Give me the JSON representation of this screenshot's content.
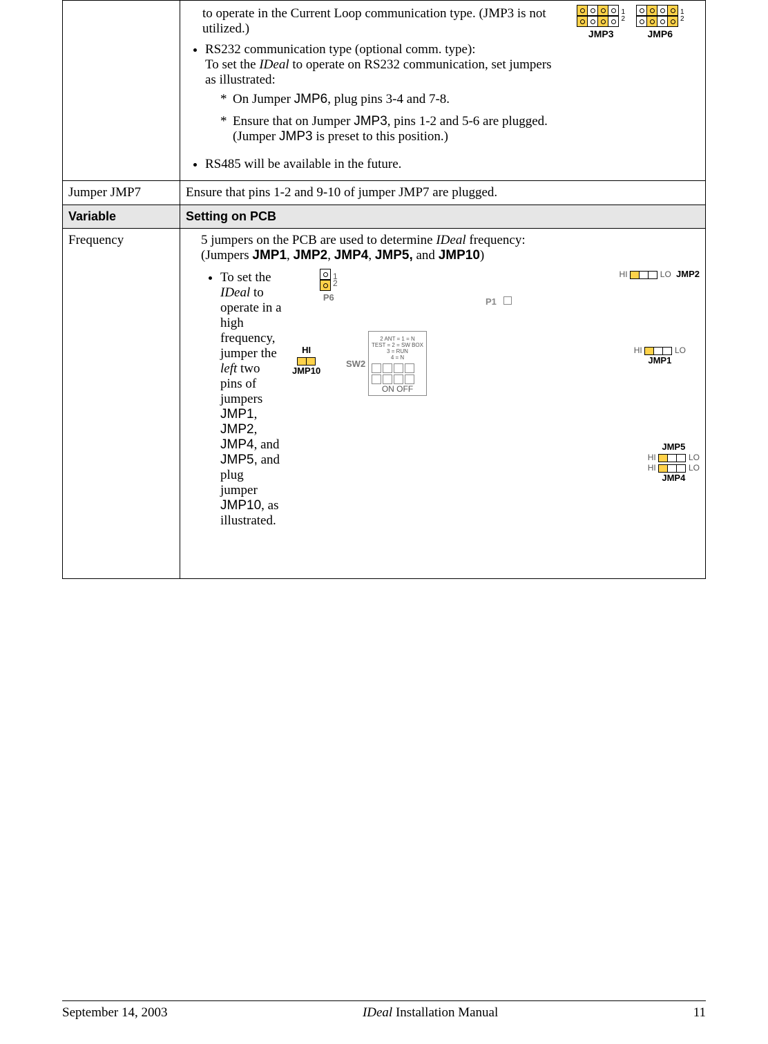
{
  "row1": {
    "para_top": "to operate in the Current Loop communication type.  (JMP3 is not utilized.)",
    "li2_a": "RS232 communication type (optional comm. type):",
    "li2_b_pre": "To set the ",
    "li2_b_ital": "IDeal",
    "li2_b_post": " to operate on RS232 communication, set jumpers as illustrated:",
    "star1_pre": "On Jumper ",
    "star1_j": "JMP6",
    "star1_post": ", plug pins 3-4 and 7-8.",
    "star2_pre": "Ensure that on Jumper ",
    "star2_j": "JMP3",
    "star2_mid": ", pins 1-2 and 5-6 are plugged.  (Jumper ",
    "star2_j2": "JMP3",
    "star2_post": " is preset to this position.)",
    "li3": "RS485 will be available in the future.",
    "jmp3_label": "JMP3",
    "jmp6_label": "JMP6",
    "rownum1": "1",
    "rownum2": "2"
  },
  "row2": {
    "label": "Jumper JMP7",
    "text": "Ensure that pins 1-2 and 9-10 of jumper JMP7 are plugged."
  },
  "headers": {
    "variable": "Variable",
    "setting": "Setting on PCB"
  },
  "freq": {
    "label": "Frequency",
    "intro_pre": "5 jumpers on the PCB are used to determine ",
    "intro_ital": "IDeal",
    "intro_post": " frequency:",
    "intro2_pre": "(Jumpers ",
    "j1": "JMP1",
    "j2": "JMP2",
    "j4": "JMP4",
    "j5": "JMP5,",
    "and": " and ",
    "j10": "JMP10",
    "intro2_post": ")",
    "comma": ", ",
    "bullet_a": "To set the ",
    "bullet_ital": "IDeal",
    "bullet_b": " to operate in a high frequency, jumper the ",
    "bullet_left": "left",
    "bullet_c": " two pins of jumpers ",
    "bj1": "JMP1",
    "bj2": "JMP2",
    "bj4": "JMP4",
    "bullet_and": " and ",
    "bj5": "JMP5,",
    "bullet_d": " and plug jumper ",
    "bj10": "JMP10",
    "bullet_e": ", as illustrated.",
    "fig": {
      "p6": "P6",
      "p6pins": "1\n2",
      "hi": "HI",
      "lo": "LO",
      "jmp10": "JMP10",
      "sw2": "SW2",
      "p1": "P1",
      "jmp2": "JMP2",
      "jmp1": "JMP1",
      "jmp5": "JMP5",
      "jmp4": "JMP4",
      "swtxt1": "2 ANT = 1 = N",
      "swtxt2": "TEST = 2 = SW BOX",
      "swtxt3": "3 = RUN",
      "swtxt4": "4 = N",
      "swbot": "ON  OFF"
    }
  },
  "footer": {
    "date": "September 14, 2003",
    "title_ital": "IDeal",
    "title_rest": " Installation Manual",
    "page": "11"
  }
}
